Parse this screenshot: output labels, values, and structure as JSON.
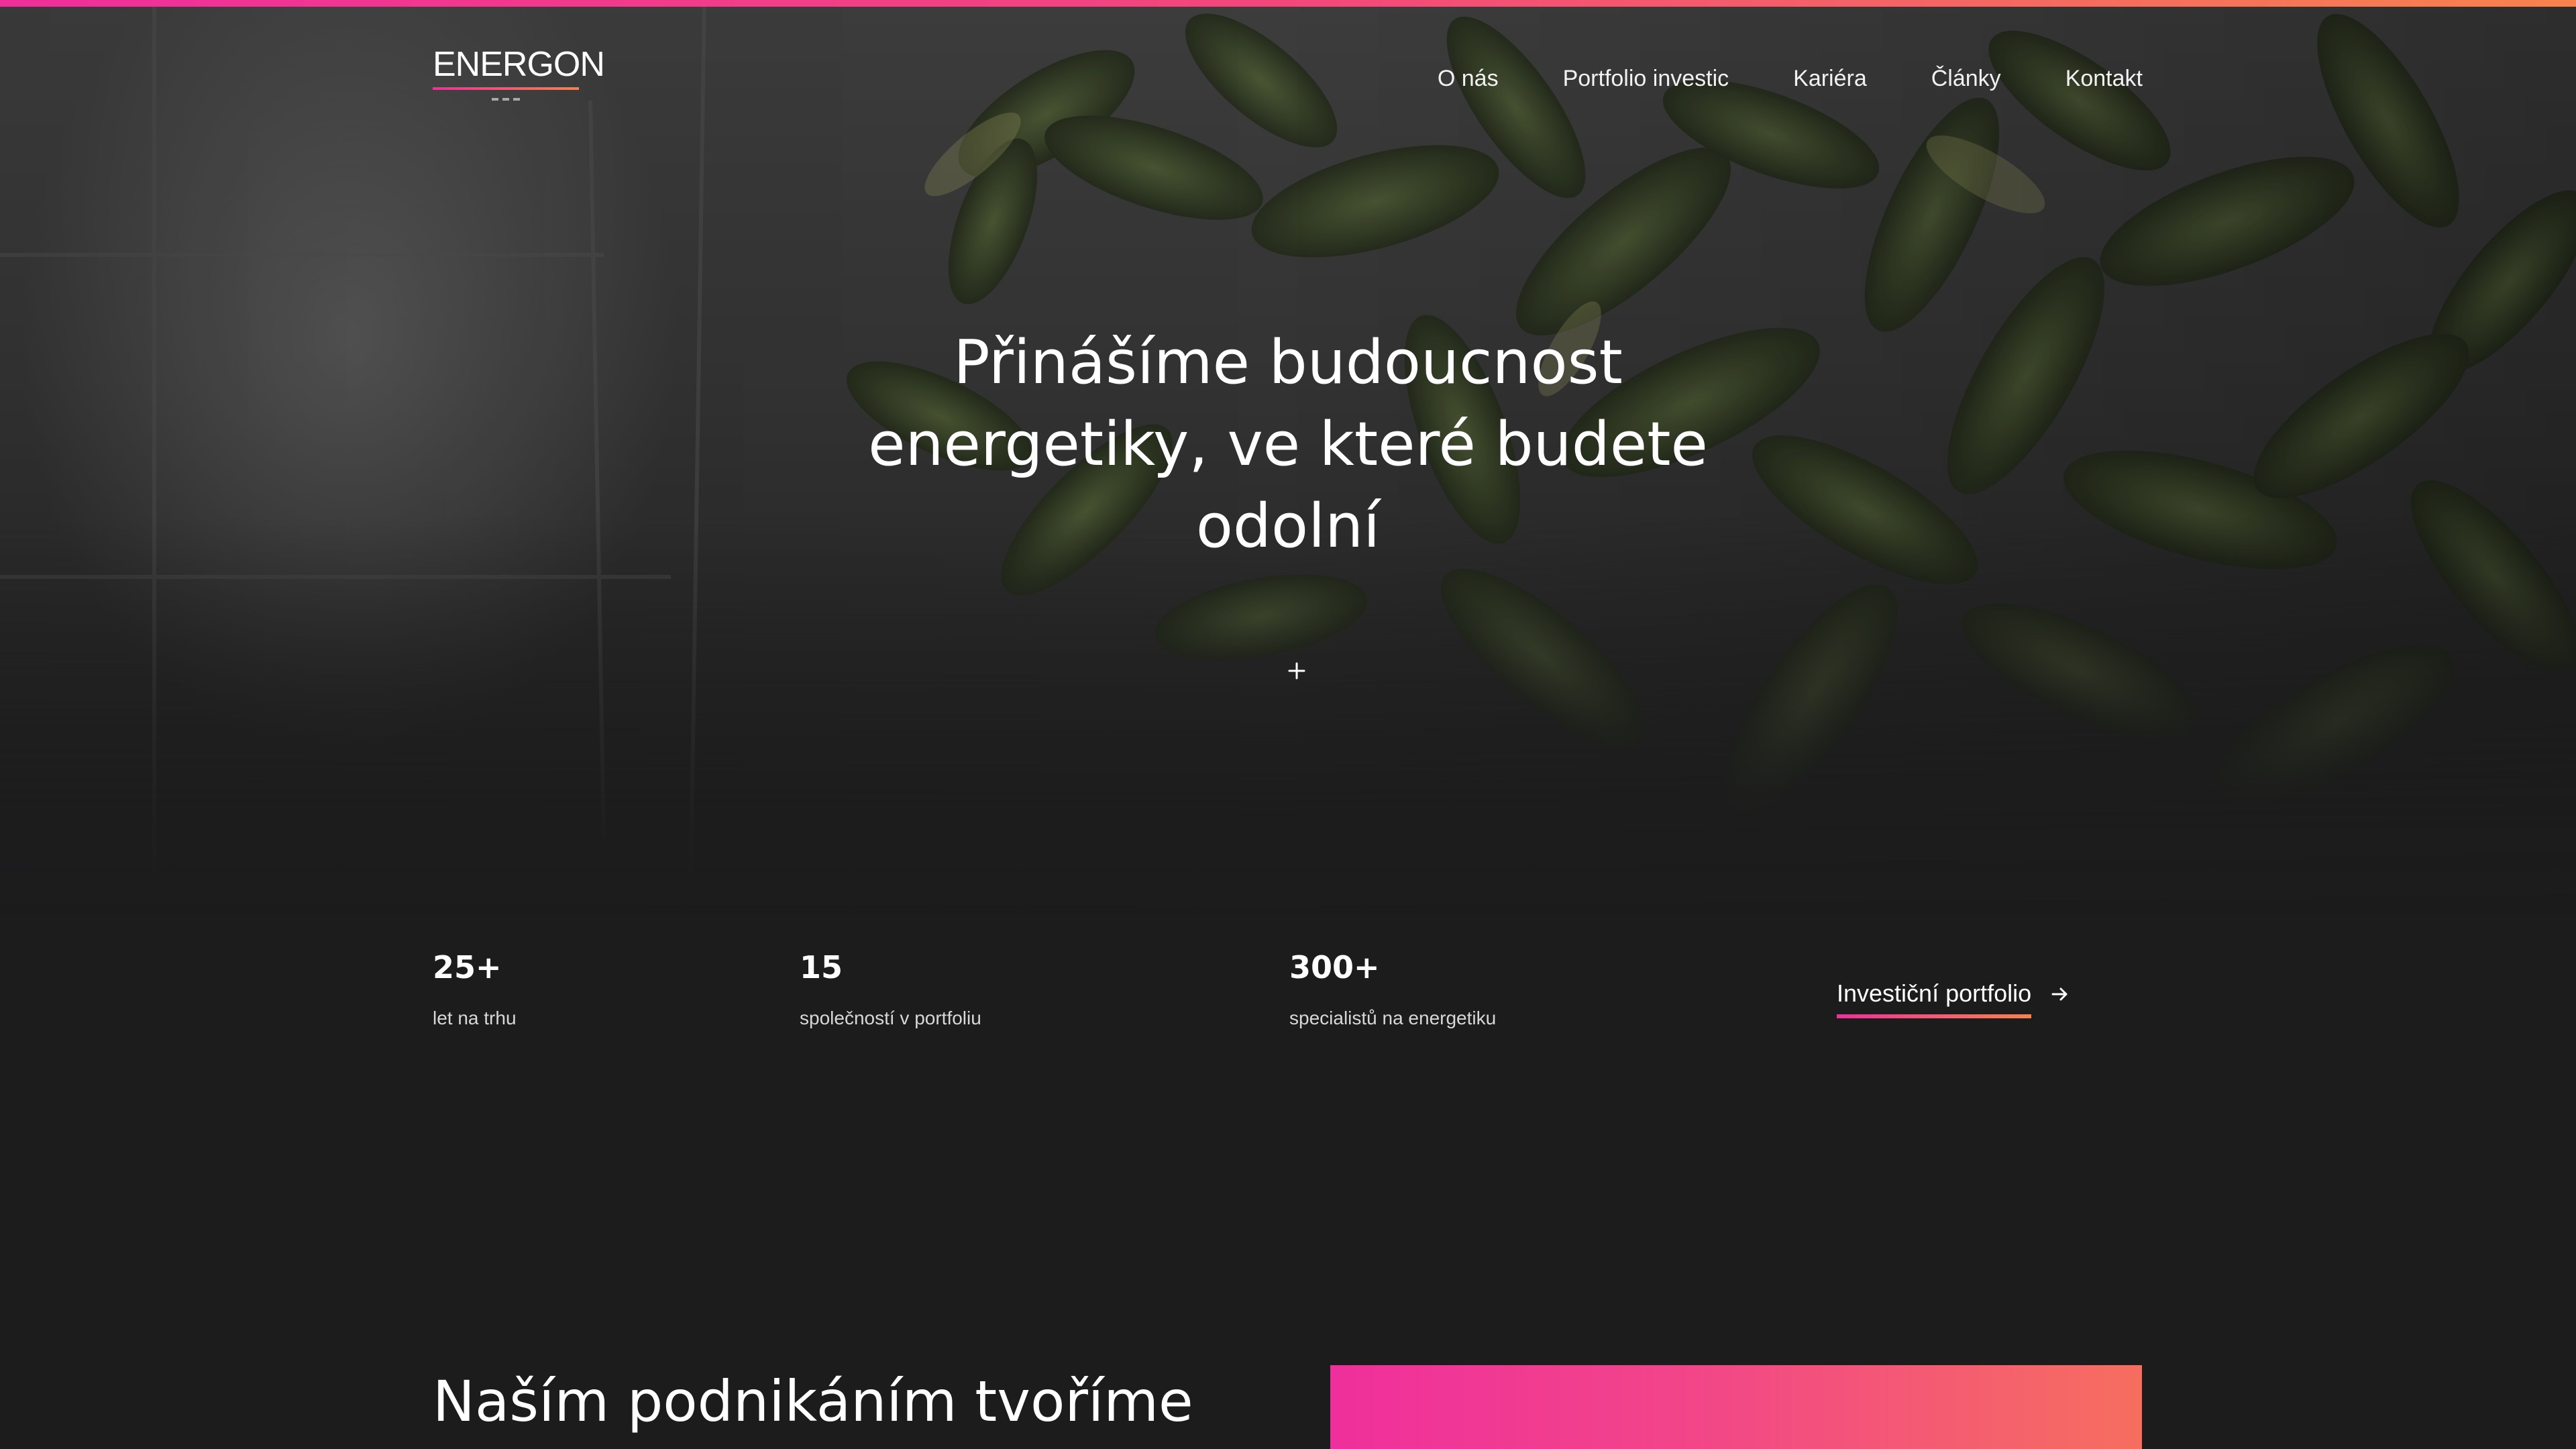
{
  "header": {
    "logo_text": "ENERGON",
    "nav": [
      "O nás",
      "Portfolio investic",
      "Kariéra",
      "Články",
      "Kontakt"
    ]
  },
  "hero": {
    "title": "Přinášíme budoucnost energetiky, ve které budete odolní",
    "scroll_icon": "plus-icon"
  },
  "stats": [
    {
      "value": "25+",
      "label": "let na trhu"
    },
    {
      "value": "15",
      "label": "společností v portfoliu"
    },
    {
      "value": "300+",
      "label": "specialistů na energetiku"
    }
  ],
  "portfolio_link": {
    "label": "Investiční portfolio",
    "icon": "arrow-right-icon"
  },
  "section": {
    "title": "Naším podnikáním tvoříme"
  },
  "colors": {
    "accent_start": "#f02f9a",
    "accent_end": "#f6834d",
    "background": "#1c1c1d"
  }
}
